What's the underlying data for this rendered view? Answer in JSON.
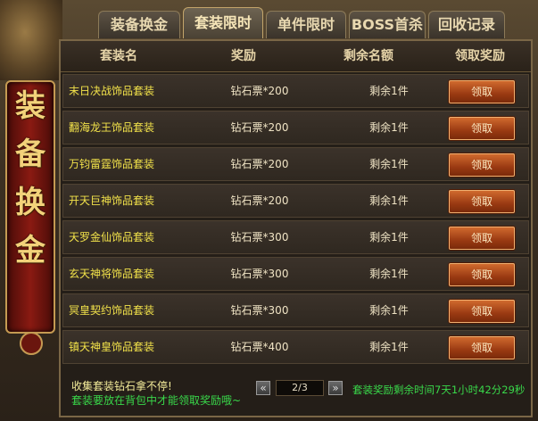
{
  "tabs": [
    {
      "label": "装备换金"
    },
    {
      "label": "套装限时"
    },
    {
      "label": "单件限时"
    },
    {
      "label": "BOSS首杀"
    },
    {
      "label": "回收记录"
    }
  ],
  "banner": {
    "chars": [
      "装",
      "备",
      "换",
      "金"
    ]
  },
  "table": {
    "headers": [
      "套装名",
      "奖励",
      "剩余名额",
      "领取奖励"
    ],
    "rows": [
      {
        "name": "末日决战饰品套装",
        "reward": "钻石票*200",
        "remaining": "剩余1件",
        "button": "领取"
      },
      {
        "name": "翻海龙王饰品套装",
        "reward": "钻石票*200",
        "remaining": "剩余1件",
        "button": "领取"
      },
      {
        "name": "万钧雷霆饰品套装",
        "reward": "钻石票*200",
        "remaining": "剩余1件",
        "button": "领取"
      },
      {
        "name": "开天巨神饰品套装",
        "reward": "钻石票*200",
        "remaining": "剩余1件",
        "button": "领取"
      },
      {
        "name": "天罗金仙饰品套装",
        "reward": "钻石票*300",
        "remaining": "剩余1件",
        "button": "领取"
      },
      {
        "name": "玄天神将饰品套装",
        "reward": "钻石票*300",
        "remaining": "剩余1件",
        "button": "领取"
      },
      {
        "name": "冥皇契约饰品套装",
        "reward": "钻石票*300",
        "remaining": "剩余1件",
        "button": "领取"
      },
      {
        "name": "镇天神皇饰品套装",
        "reward": "钻石票*400",
        "remaining": "剩余1件",
        "button": "领取"
      }
    ]
  },
  "footer": {
    "line1": "收集套装钻石拿不停!",
    "line2": "套装要放在背包中才能领取奖励哦~",
    "prev_icon": "chevron-double-left-icon",
    "next_icon": "chevron-double-right-icon",
    "page": "2/3",
    "timer": "套装奖励剩余时间7天1小时42分29秒"
  },
  "colors": {
    "name_text": "#f2e24a",
    "green_text": "#39d84a",
    "button": "#b8501e"
  }
}
